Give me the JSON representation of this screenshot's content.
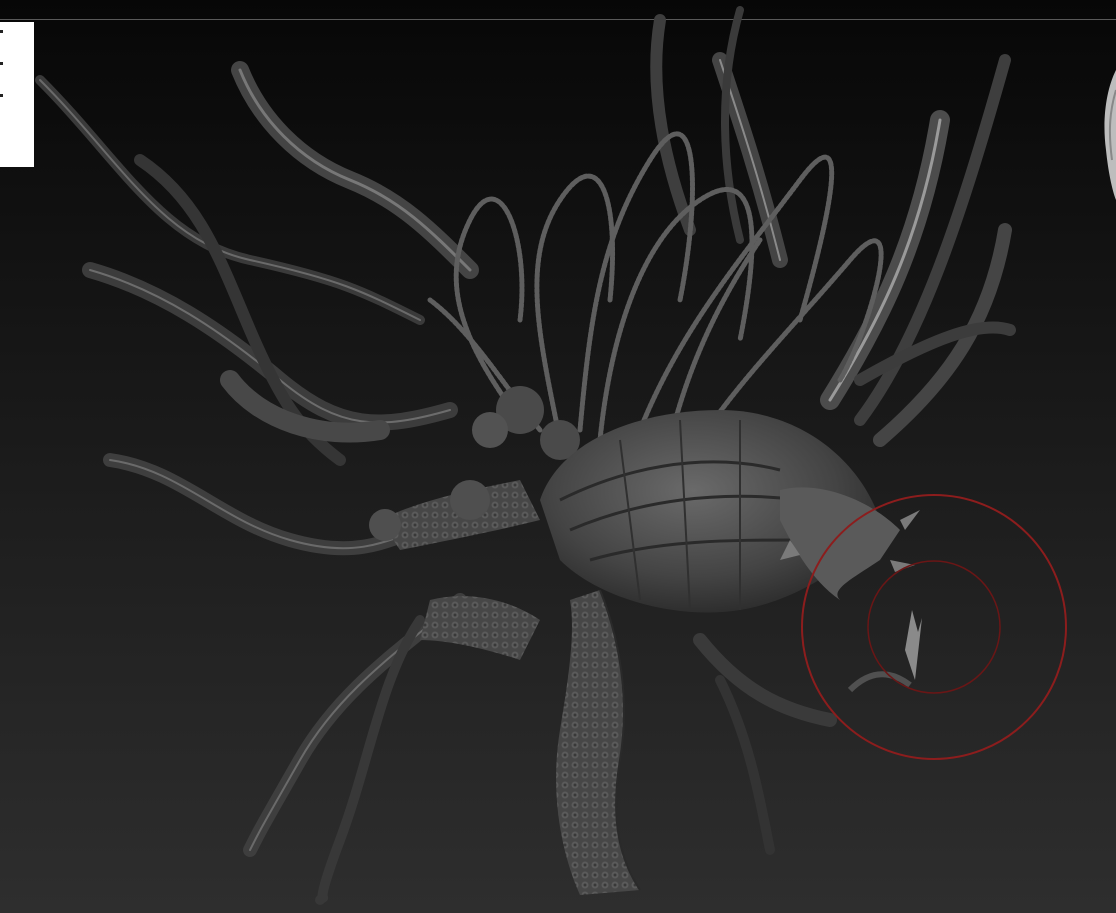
{
  "viewport": {
    "subject": "sculpted-creature-mesh",
    "background_top": "#070707",
    "background_bottom": "#2e2e2e"
  },
  "colors": {
    "mesh_fill": "#4a4a4a",
    "mesh_highlight": "#8a8a8a",
    "mesh_shadow": "#1a1a1a",
    "brush_outer": "#8c1d1d",
    "brush_inner": "#6a1616",
    "nav_widget": "#ffffff"
  },
  "icons": {
    "brush": "brush-cursor-icon",
    "navigator": "navigation-gizmo-icon"
  }
}
